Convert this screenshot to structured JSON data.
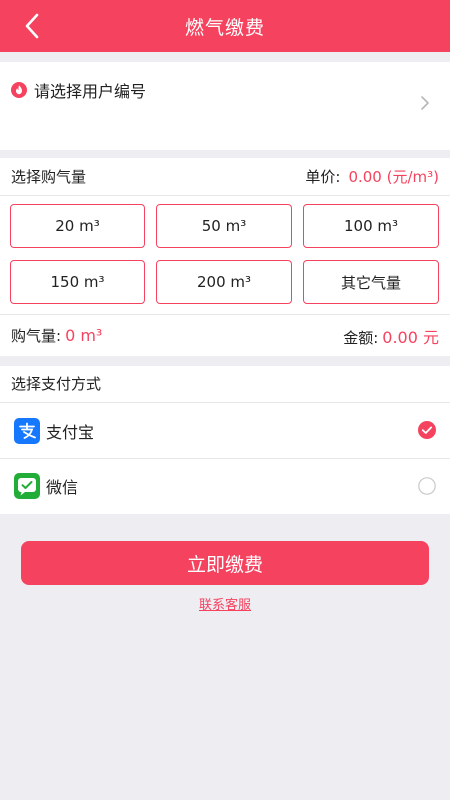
{
  "header": {
    "title": "燃气缴费"
  },
  "account": {
    "label": "请选择用户编号"
  },
  "purchase": {
    "section_title": "选择购气量",
    "unit_price_label": "单价:",
    "unit_price_value": "0.00 (元/m³)",
    "options": [
      "20 m³",
      "50 m³",
      "100 m³",
      "150 m³",
      "200 m³",
      "其它气量"
    ],
    "amount_label": "购气量:",
    "amount_value": "0 m³",
    "total_label": "金额:",
    "total_value": "0.00 元"
  },
  "payment": {
    "section_title": "选择支付方式",
    "methods": [
      {
        "name": "支付宝",
        "selected": true
      },
      {
        "name": "微信",
        "selected": false
      }
    ]
  },
  "actions": {
    "submit": "立即缴费",
    "contact": "联系客服"
  },
  "colors": {
    "brand": "#f5435f",
    "alipay": "#1677ff",
    "wechat": "#22ac38"
  }
}
